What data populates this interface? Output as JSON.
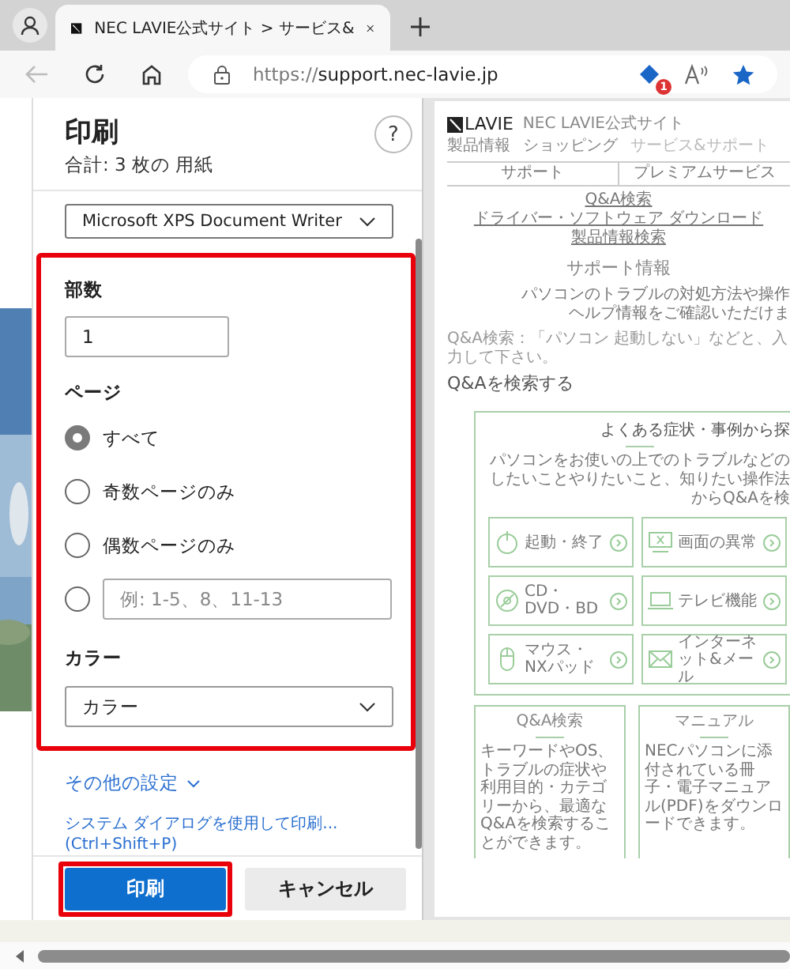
{
  "browser": {
    "tab": {
      "title": "NEC LAVIE公式サイト > サービス&",
      "selected": true
    },
    "address": {
      "scheme": "https://",
      "host": "support.nec-lavie.jp"
    },
    "extension_badge": "1"
  },
  "print_dialog": {
    "title": "印刷",
    "subtitle": "合計: 3 枚の 用紙",
    "help": "?",
    "printer": "Microsoft XPS Document Writer",
    "highlight_settings": true,
    "copies": {
      "label": "部数",
      "value": "1"
    },
    "pages": {
      "label": "ページ",
      "options": [
        {
          "kind": "plain",
          "label": "すべて",
          "selected": true
        },
        {
          "kind": "plain",
          "label": "奇数ページのみ",
          "selected": false
        },
        {
          "kind": "plain",
          "label": "偶数ページのみ",
          "selected": false
        },
        {
          "kind": "custom",
          "placeholder": "例: 1-5、8、11-13",
          "selected": false
        }
      ]
    },
    "color": {
      "label": "カラー",
      "value": "カラー"
    },
    "more_settings": "その他の設定",
    "system_dialog": "システム ダイアログを使用して印刷... (Ctrl+Shift+P)",
    "buttons": [
      {
        "kind": "primary",
        "label": "印刷",
        "highlighted": true
      },
      {
        "kind": "secondary",
        "label": "キャンセル",
        "highlighted": false
      }
    ]
  },
  "preview": {
    "logo": "LAVIE",
    "site_name": "NEC LAVIE公式サイト",
    "nav": [
      "製品情報",
      "ショッピング",
      "サービス&サポート"
    ],
    "sections": [
      "サポート",
      "プレミアムサービス"
    ],
    "links": [
      "Q&A検索",
      "ドライバー・ソフトウェア ダウンロード",
      "製品情報検索"
    ],
    "heading": "サポート情報",
    "lead": [
      "パソコンのトラブルの対処方法や操作",
      "ヘルプ情報をご確認いただけま"
    ],
    "search_hint": "Q&A検索：「パソコン 起動しない」などと、入力して下さい。",
    "search_label": "Q&Aを検索する",
    "symptoms": {
      "title": "よくある症状・事例から探",
      "description": [
        "パソコンをお使いの上でのトラブルなどの",
        "したいことやりたいこと、知りたい操作法からQ&Aを検"
      ],
      "items": [
        {
          "kind": "power",
          "label": "起動・終了"
        },
        {
          "kind": "screen",
          "label": "画面の異常"
        },
        {
          "kind": "disc",
          "label": "CD・DVD・BD"
        },
        {
          "kind": "tv",
          "label": "テレビ機能"
        },
        {
          "kind": "mouse",
          "label": "マウス・NXパッド"
        },
        {
          "kind": "mail",
          "label": "インターネット&メール"
        }
      ]
    },
    "cards": [
      {
        "title": "Q&A検索",
        "text": "キーワードやOS、トラブルの症状や利用目的・カテゴリーから、最適なQ&Aを検索することができます。"
      },
      {
        "title": "マニュアル",
        "text": "NECパソコンに添付されている冊子・電子マニュアル(PDF)をダウンロードできます。"
      }
    ]
  }
}
